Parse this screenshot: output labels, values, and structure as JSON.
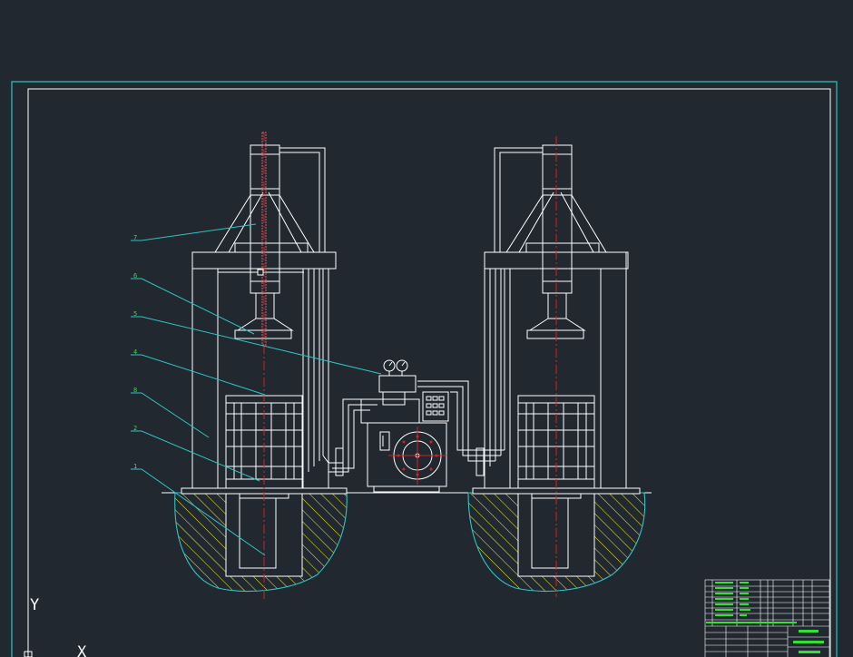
{
  "colors": {
    "background": "#212830",
    "outer_frame": "#2fc4c4",
    "inner_frame": "#ffffff",
    "geometry": "#ffffff",
    "center_line": "#d92020",
    "hatch": "#e6e02a",
    "soil_outline": "#2fc4c4",
    "leaders": "#2fc4c4",
    "balloon_text": "#34e034",
    "title_block_lines": "#ffffff",
    "title_block_text": "#34e034"
  },
  "balloons": [
    "7",
    "6",
    "5",
    "4",
    "8",
    "2",
    "1"
  ],
  "ucs": {
    "y_label": "Y",
    "x_label": "X"
  },
  "icons": {
    "gauges": "pressure-gauge-icon",
    "motor": "electric-motor-icon",
    "control_panel": "control-panel-icon"
  }
}
